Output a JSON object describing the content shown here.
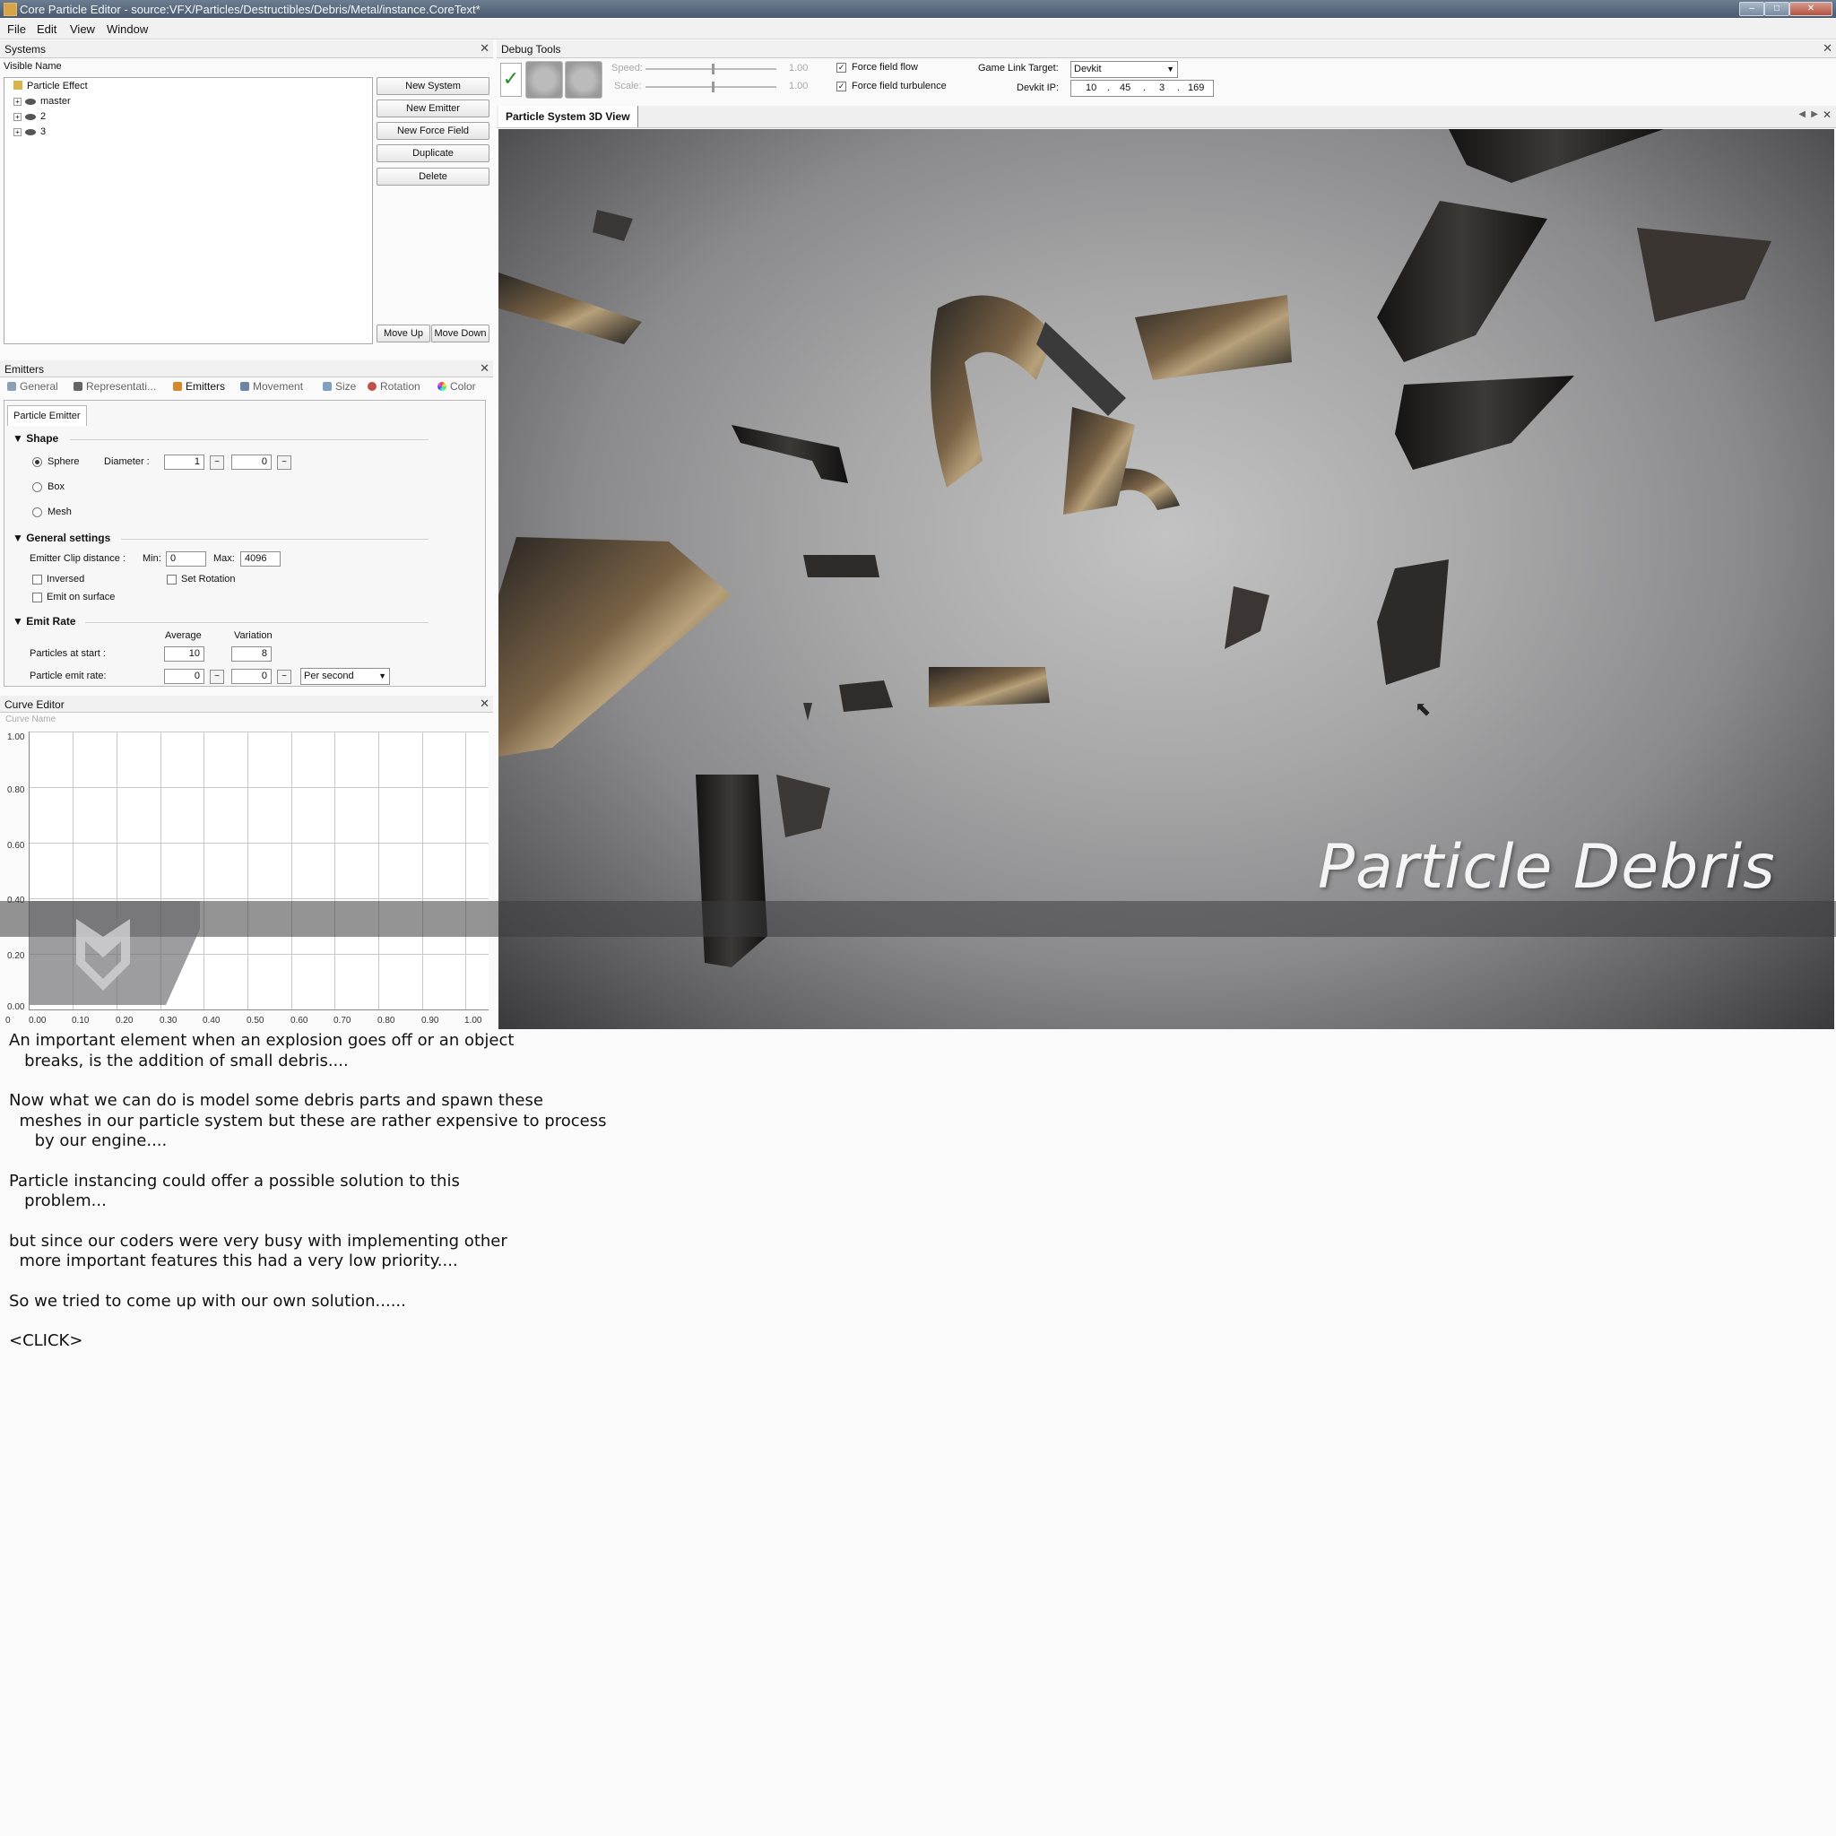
{
  "window": {
    "title": "Core Particle Editor - source:VFX/Particles/Destructibles/Debris/Metal/instance.CoreText*",
    "controls": [
      "–",
      "□",
      "✕"
    ]
  },
  "menu": [
    "File",
    "Edit",
    "View",
    "Window"
  ],
  "systems_panel": {
    "title": "Systems",
    "column_header": "Visible Name",
    "tree": [
      "Particle Effect",
      "master",
      "2",
      "3"
    ],
    "buttons": {
      "new_system": "New System",
      "new_emitter": "New Emitter",
      "new_force_field": "New Force Field",
      "duplicate": "Duplicate",
      "delete": "Delete",
      "move_up": "Move Up",
      "move_down": "Move Down"
    }
  },
  "emitters_panel": {
    "title": "Emitters",
    "tabs": [
      "General",
      "Representati...",
      "Emitters",
      "Movement",
      "Size",
      "Rotation",
      "Color"
    ],
    "active_tab": "Emitters",
    "sub_tab": "Particle Emitter",
    "shape": {
      "heading": "Shape",
      "options": [
        "Sphere",
        "Box",
        "Mesh"
      ],
      "selected": "Sphere",
      "diameter_label": "Diameter :",
      "diameter_value_1": "1",
      "diameter_value_2": "0"
    },
    "general_settings": {
      "heading": "General settings",
      "clip_label": "Emitter Clip distance :",
      "min_label": "Min:",
      "min_value": "0",
      "max_label": "Max:",
      "max_value": "4096",
      "inversed": "Inversed",
      "set_rotation": "Set Rotation",
      "emit_on_surface": "Emit on surface"
    },
    "emit_rate": {
      "heading": "Emit Rate",
      "average_label": "Average",
      "variation_label": "Variation",
      "start_label": "Particles at start :",
      "start_avg": "10",
      "start_var": "8",
      "rate_label": "Particle emit rate:",
      "rate_avg": "0",
      "rate_var": "0",
      "unit": "Per second"
    }
  },
  "curve_editor": {
    "title": "Curve Editor",
    "curve_name_placeholder": "Curve Name",
    "y_ticks": [
      "1.00",
      "0.80",
      "0.60",
      "0.40",
      "0.20",
      "0.00"
    ],
    "x_ticks": [
      "0",
      "0.00",
      "0.10",
      "0.20",
      "0.30",
      "0.40",
      "0.50",
      "0.60",
      "0.70",
      "0.80",
      "0.90",
      "1.00"
    ]
  },
  "debug_tools": {
    "title": "Debug Tools",
    "speed_label": "Speed:",
    "speed_value": "1.00",
    "scale_label": "Scale:",
    "scale_value": "1.00",
    "force_field_flow": "Force field flow",
    "force_field_turbulence": "Force field turbulence",
    "game_link_label": "Game Link Target:",
    "game_link_value": "Devkit",
    "devkit_ip_label": "Devkit IP:",
    "ip": [
      "10",
      "45",
      "3",
      "169"
    ]
  },
  "view3d": {
    "tab_title": "Particle System 3D View",
    "overlay_title": "Particle Debris"
  },
  "notes": [
    "An important element when an explosion goes off or an object\n   breaks, is the addition of small debris....",
    "Now what we can do is model some debris parts and spawn these\n  meshes in our particle system but these are rather expensive to process\n     by our engine....",
    "Particle instancing could offer a possible solution to this\n   problem...",
    "but since our coders were very busy with implementing other\n  more important features this had a very low priority....",
    "So we tried to come up with our own solution......",
    "<CLICK>"
  ]
}
